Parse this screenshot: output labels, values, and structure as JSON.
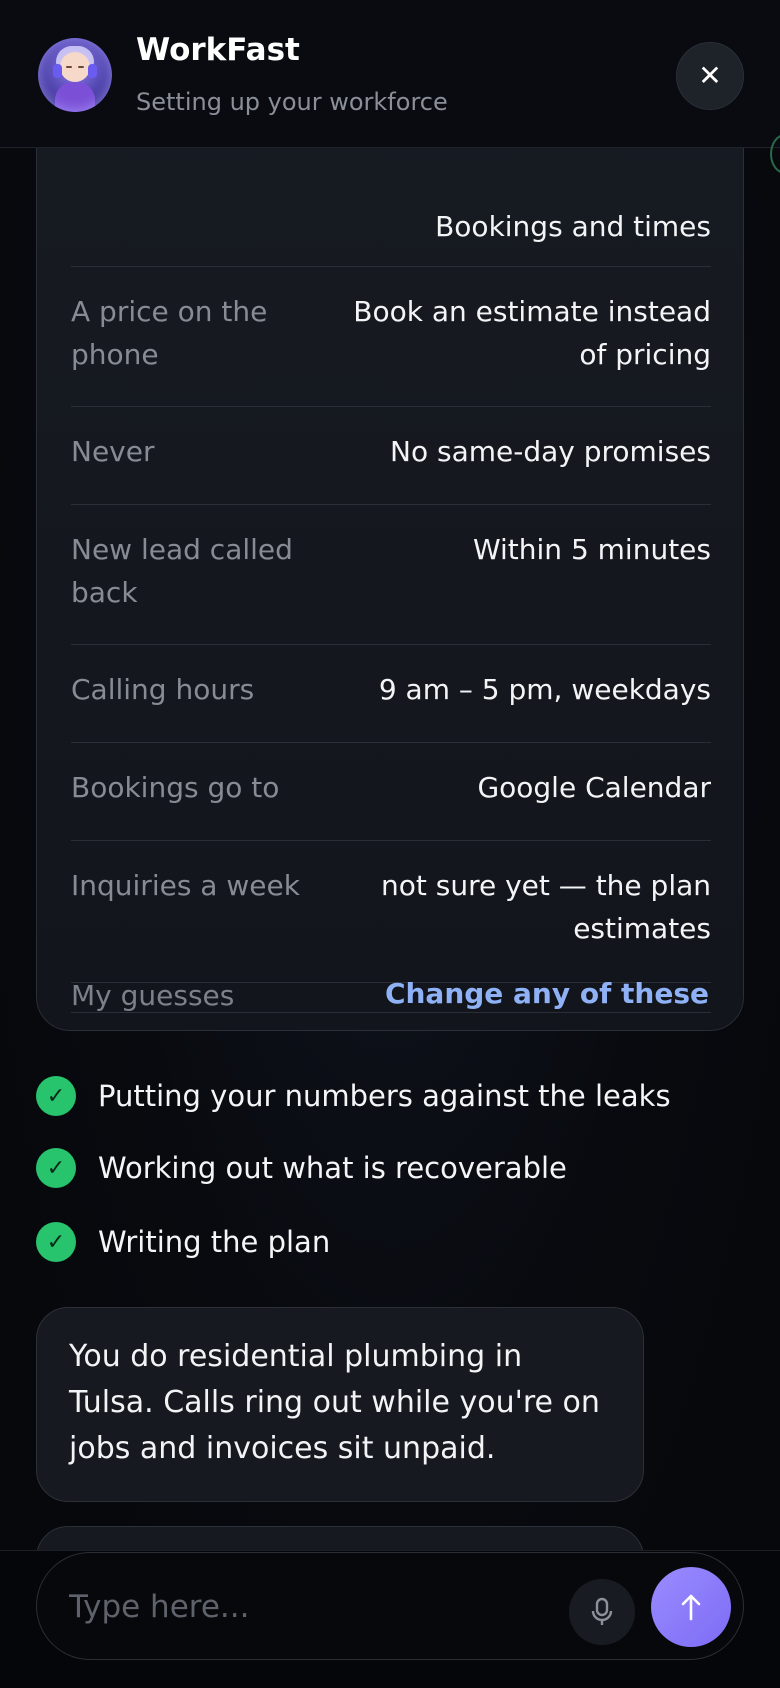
{
  "header": {
    "title": "WorkFast",
    "subtitle": "Setting up your workforce",
    "close_symbol": "✕"
  },
  "summary": {
    "rows": [
      {
        "label": "",
        "value": "Bookings and times"
      },
      {
        "label": "A price on the phone",
        "value": "Book an estimate instead of pricing"
      },
      {
        "label": "Never",
        "value": "No same-day promises"
      },
      {
        "label": "New lead called back",
        "value": "Within 5 minutes"
      },
      {
        "label": "Calling hours",
        "value": "9 am – 5 pm, weekdays"
      },
      {
        "label": "Bookings go to",
        "value": "Google Calendar"
      },
      {
        "label": "Inquiries a week",
        "value": "not sure yet — the plan estimates"
      }
    ],
    "guesses_label": "My guesses",
    "change_link": "Change any of these"
  },
  "progress_steps": [
    {
      "label": "Putting your numbers against the leaks",
      "status": "done"
    },
    {
      "label": "Working out what is recoverable",
      "status": "done"
    },
    {
      "label": "Writing the plan",
      "status": "done"
    }
  ],
  "messages": [
    {
      "text": "You do residential plumbing in Tulsa. Calls ring out while you're on jobs and invoices sit unpaid."
    },
    {
      "text": ""
    }
  ],
  "composer": {
    "placeholder": "Type here...",
    "value": "",
    "send_symbol": "↑"
  },
  "colors": {
    "accent": "#8f7ffb",
    "success": "#27c46d",
    "link": "#8fb2f6"
  },
  "icons": {
    "close": "close-icon",
    "check": "check-icon",
    "mic": "microphone-icon",
    "send": "arrow-up-icon"
  }
}
